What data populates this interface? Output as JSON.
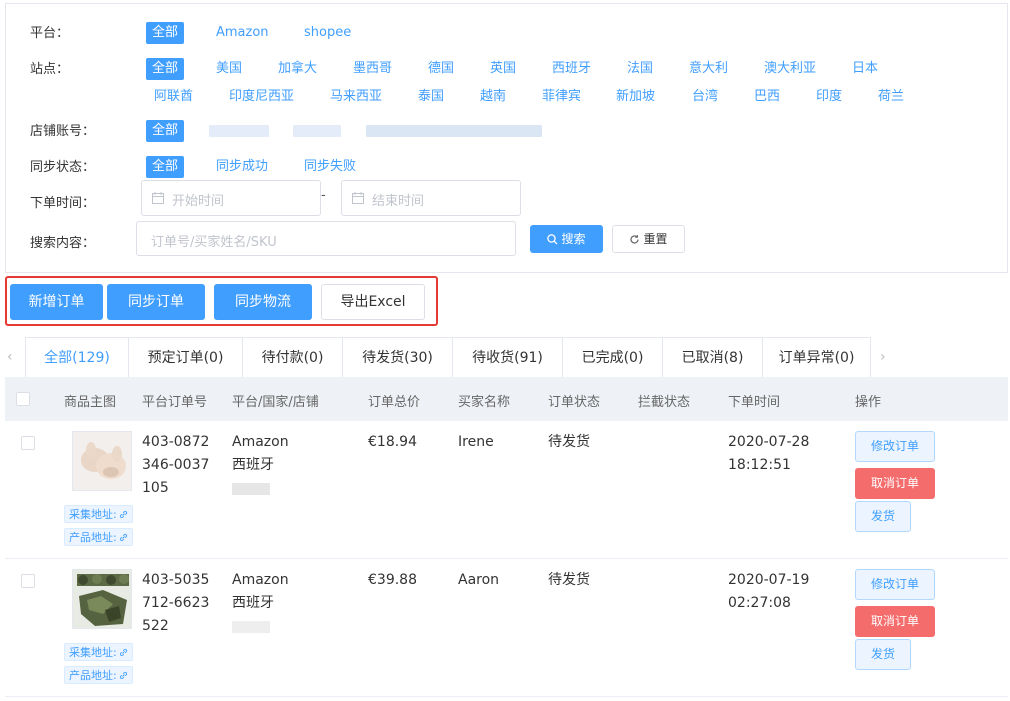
{
  "filters": {
    "platform": {
      "label": "平台：",
      "options": [
        "全部",
        "Amazon",
        "shopee"
      ]
    },
    "site": {
      "label": "站点：",
      "options": [
        "全部",
        "美国",
        "加拿大",
        "墨西哥",
        "德国",
        "英国",
        "西班牙",
        "法国",
        "意大利",
        "澳大利亚",
        "日本",
        "阿联酋",
        "印度尼西亚",
        "马来西亚",
        "泰国",
        "越南",
        "菲律宾",
        "新加坡",
        "台湾",
        "巴西",
        "印度",
        "荷兰"
      ]
    },
    "shop": {
      "label": "店铺账号：",
      "all": "全部"
    },
    "sync": {
      "label": "同步状态：",
      "options": [
        "全部",
        "同步成功",
        "同步失败"
      ]
    },
    "order_time": {
      "label": "下单时间：",
      "start_placeholder": "开始时间",
      "end_placeholder": "结束时间",
      "separator": "-"
    },
    "search": {
      "label": "搜索内容：",
      "placeholder": "订单号/买家姓名/SKU",
      "search_btn": "搜索",
      "reset_btn": "重置"
    }
  },
  "actions": {
    "add": "新增订单",
    "sync_orders": "同步订单",
    "sync_logistics": "同步物流",
    "export": "导出Excel"
  },
  "tabs": [
    "全部(129)",
    "预定订单(0)",
    "待付款(0)",
    "待发货(30)",
    "待收货(91)",
    "已完成(0)",
    "已取消(8)",
    "订单异常(0)"
  ],
  "table": {
    "headers": [
      "商品主图",
      "平台订单号",
      "平台/国家/店铺",
      "订单总价",
      "买家名称",
      "订单状态",
      "拦截状态",
      "下单时间",
      "操作"
    ],
    "rows": [
      {
        "order_no": [
          "403-0872",
          "346-0037",
          "105"
        ],
        "platform": "Amazon",
        "country": "西班牙",
        "total": "€18.94",
        "buyer": "Irene",
        "status": "待发货",
        "date": "2020-07-28",
        "time": "18:12:51"
      },
      {
        "order_no": [
          "403-5035",
          "712-6623",
          "522"
        ],
        "platform": "Amazon",
        "country": "西班牙",
        "total": "€39.88",
        "buyer": "Aaron",
        "status": "待发货",
        "date": "2020-07-19",
        "time": "02:27:08"
      }
    ],
    "collect_link": "采集地址:",
    "product_link": "产品地址:",
    "op_edit": "修改订单",
    "op_cancel": "取消订单",
    "op_ship": "发货"
  },
  "colors": {
    "primary": "#409eff",
    "danger": "#f56c6c",
    "highlight_border": "#e53935"
  }
}
